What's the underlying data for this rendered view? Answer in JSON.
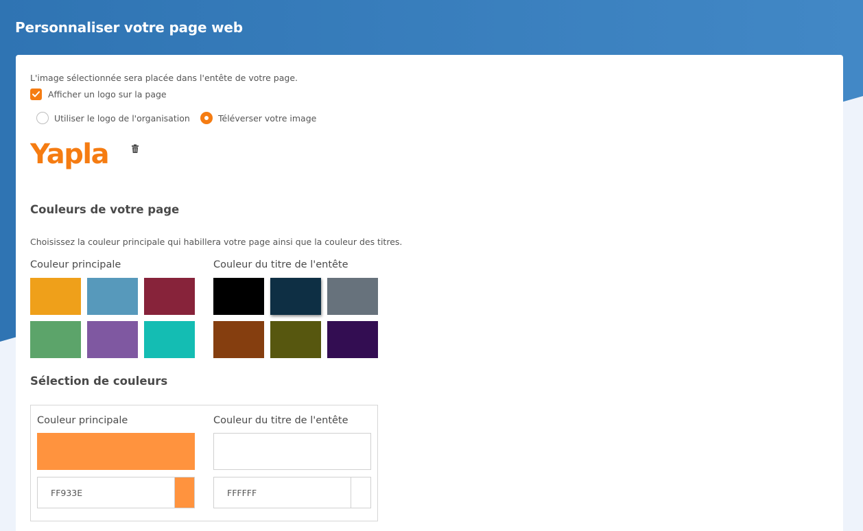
{
  "header": {
    "title": "Personnaliser votre page web"
  },
  "logo_section": {
    "intro": "L'image sélectionnée sera placée dans l'entête de votre page.",
    "show_logo_label": "Afficher un logo sur la page",
    "show_logo_checked": true,
    "radio_options": [
      {
        "label": "Utiliser le logo de l'organisation",
        "checked": false
      },
      {
        "label": "Téléverser votre image",
        "checked": true
      }
    ],
    "logo_text": "Yapla"
  },
  "colors_section": {
    "title": "Couleurs de votre page",
    "description": "Choisissez la couleur principale qui habillera votre page ainsi que la couleur des titres.",
    "primary_label": "Couleur principale",
    "header_title_label": "Couleur du titre de l'entête",
    "primary_swatches": [
      "#EFA01A",
      "#5799BB",
      "#87233A",
      "#5CA46A",
      "#7F58A1",
      "#14BDB3"
    ],
    "header_title_swatches": [
      "#000000",
      "#0E2F44",
      "#67727C",
      "#853E0F",
      "#57570F",
      "#330D52"
    ],
    "header_title_selected_index": 1
  },
  "selection_section": {
    "title": "Sélection de couleurs",
    "primary_label": "Couleur principale",
    "header_title_label": "Couleur du titre de l'entête",
    "primary_hex": "FF933E",
    "primary_color": "#FF933E",
    "header_title_hex": "FFFFFF",
    "header_title_color": "#FFFFFF"
  },
  "theme": {
    "accent": "#F57C12",
    "header_blue": "#3479B8",
    "logo_orange": "#F57C12"
  }
}
